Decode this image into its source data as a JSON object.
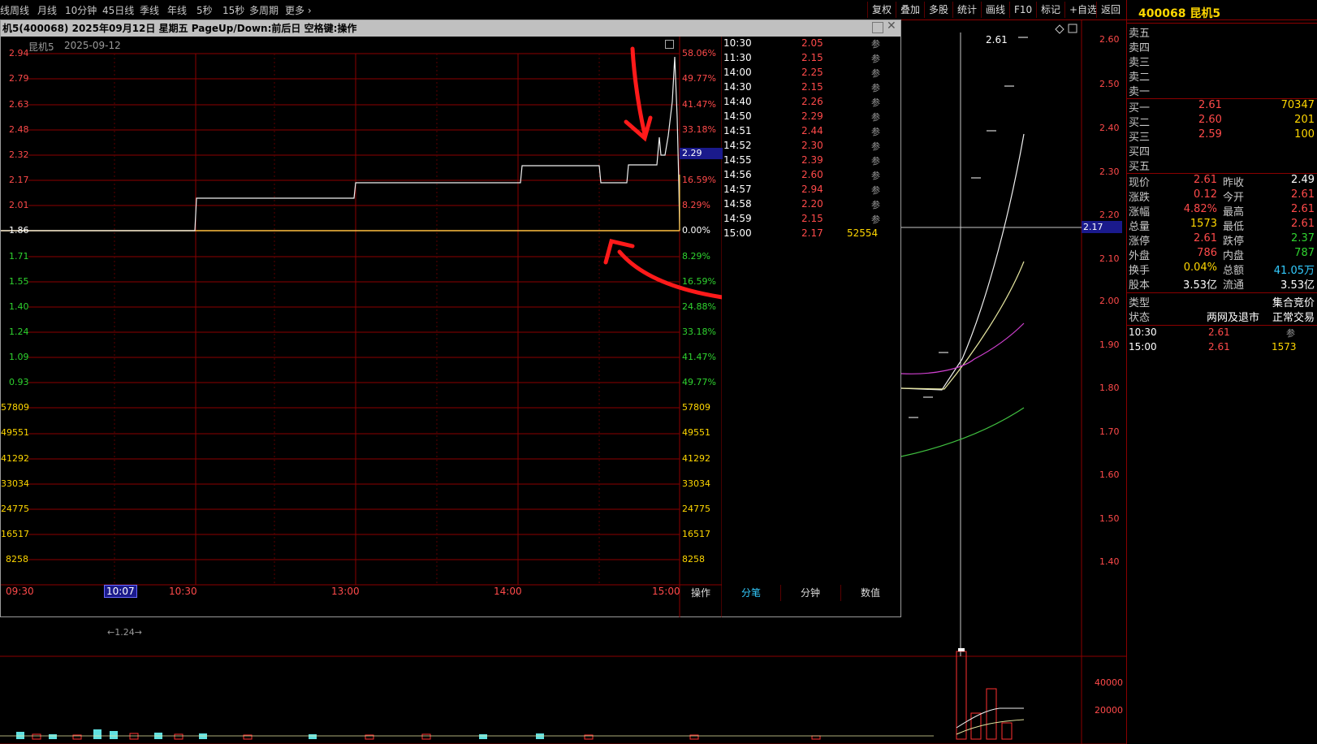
{
  "toolbar": {
    "left_fragment": "线",
    "items": [
      "周线",
      "月线",
      "10分钟",
      "45日线",
      "季线",
      "年线",
      "5秒",
      "15秒",
      "多周期",
      "更多"
    ],
    "right_items": [
      "复权",
      "叠加",
      "多股",
      "统计",
      "画线",
      "F10",
      "标记",
      "+自选",
      "返回"
    ]
  },
  "popup": {
    "title": "机5(400068)  2025年09月12日 星期五  PageUp/Down:前后日  空格键:操作",
    "chart_title": "昆机5",
    "chart_date": "2025-09-12",
    "price_badge": "2.29",
    "left_price_labels": [
      "2.94",
      "2.79",
      "2.63",
      "2.48",
      "2.32",
      "2.17",
      "2.01",
      "1.86",
      "1.71",
      "1.55",
      "1.40",
      "1.24",
      "1.09",
      "0.93"
    ],
    "right_pct_labels": [
      "58.06%",
      "49.77%",
      "41.47%",
      "33.18%",
      "24.88%",
      "16.59%",
      "8.29%",
      "0.00%",
      "8.29%",
      "16.59%",
      "24.88%",
      "33.18%",
      "41.47%",
      "49.77%"
    ],
    "volume_labels": [
      "57809",
      "49551",
      "41292",
      "33034",
      "24775",
      "16517",
      "8258"
    ],
    "time_labels": [
      "09:30",
      "10:07",
      "10:30",
      "13:00",
      "14:00",
      "15:00"
    ],
    "ticks": [
      {
        "time": "10:30",
        "price": "2.05",
        "tag": "参"
      },
      {
        "time": "11:30",
        "price": "2.15",
        "tag": "参"
      },
      {
        "time": "14:00",
        "price": "2.25",
        "tag": "参"
      },
      {
        "time": "14:30",
        "price": "2.15",
        "tag": "参"
      },
      {
        "time": "14:40",
        "price": "2.26",
        "tag": "参"
      },
      {
        "time": "14:50",
        "price": "2.29",
        "tag": "参"
      },
      {
        "time": "14:51",
        "price": "2.44",
        "tag": "参"
      },
      {
        "time": "14:52",
        "price": "2.30",
        "tag": "参"
      },
      {
        "time": "14:55",
        "price": "2.39",
        "tag": "参"
      },
      {
        "time": "14:56",
        "price": "2.60",
        "tag": "参"
      },
      {
        "time": "14:57",
        "price": "2.94",
        "tag": "参"
      },
      {
        "time": "14:58",
        "price": "2.20",
        "tag": "参"
      },
      {
        "time": "14:59",
        "price": "2.15",
        "tag": "参"
      },
      {
        "time": "15:00",
        "price": "2.17",
        "tag": "52554"
      }
    ],
    "tabs": [
      "操作",
      "分笔",
      "分钟",
      "数值"
    ]
  },
  "kline": {
    "y_labels": [
      "2.60",
      "2.50",
      "2.40",
      "2.30",
      "2.20",
      "2.10",
      "2.00",
      "1.90",
      "1.80",
      "1.70",
      "1.60",
      "1.50",
      "1.40"
    ],
    "high_label": "2.61",
    "cursor_badge": "2.17",
    "low_label": "1.24",
    "vol_labels": [
      "40000",
      "20000"
    ]
  },
  "quote": {
    "header": "400068 昆机5",
    "sell": [
      "卖五",
      "卖四",
      "卖三",
      "卖二",
      "卖一"
    ],
    "buy": [
      {
        "label": "买一",
        "price": "2.61",
        "vol": "70347"
      },
      {
        "label": "买二",
        "price": "2.60",
        "vol": "201"
      },
      {
        "label": "买三",
        "price": "2.59",
        "vol": "100"
      },
      {
        "label": "买四",
        "price": "",
        "vol": ""
      },
      {
        "label": "买五",
        "price": "",
        "vol": ""
      }
    ],
    "stats": [
      {
        "l1": "现价",
        "v1": "2.61",
        "l2": "昨收",
        "v2": "2.49"
      },
      {
        "l1": "涨跌",
        "v1": "0.12",
        "l2": "今开",
        "v2": "2.61"
      },
      {
        "l1": "涨幅",
        "v1": "4.82%",
        "l2": "最高",
        "v2": "2.61"
      },
      {
        "l1": "总量",
        "v1": "1573",
        "l2": "最低",
        "v2": "2.61"
      },
      {
        "l1": "涨停",
        "v1": "2.61",
        "l2": "跌停",
        "v2": "2.37"
      },
      {
        "l1": "外盘",
        "v1": "786",
        "l2": "内盘",
        "v2": "787"
      },
      {
        "l1": "换手",
        "v1": "0.04%",
        "l2": "总额",
        "v2": "41.05万"
      },
      {
        "l1": "股本",
        "v1": "3.53亿",
        "l2": "流通",
        "v2": "3.53亿"
      }
    ],
    "type_label": "类型",
    "type_value": "集合竞价",
    "status_label": "状态",
    "status_value1": "两网及退市",
    "status_value2": "正常交易",
    "trades": [
      {
        "time": "10:30",
        "price": "2.61",
        "vol": "参"
      },
      {
        "time": "15:00",
        "price": "2.61",
        "vol": "1573"
      }
    ]
  }
}
